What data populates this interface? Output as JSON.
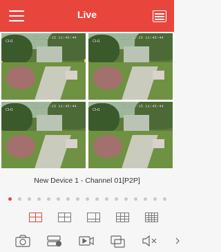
{
  "header": {
    "title": "Live"
  },
  "cameras": [
    {
      "timestamp": "2016-12-15 11:45:44",
      "channel": "CH1",
      "selected": true
    },
    {
      "timestamp": "2016-12-15 11:45:44",
      "channel": "CH1",
      "selected": false
    },
    {
      "timestamp": "2016-12-15 11:45:44",
      "channel": "CH1",
      "selected": false
    },
    {
      "timestamp": "2016-12-15 11:45:44",
      "channel": "CH1",
      "selected": false
    }
  ],
  "device_name": "New Device 1 - Channel 01[P2P]",
  "pager": {
    "total": 17,
    "active_index": 0
  },
  "layouts": [
    "layout-1x4-icon",
    "layout-2x2-icon",
    "layout-1plus3-icon",
    "layout-3x3-icon",
    "layout-4x4-icon"
  ],
  "toolbar": [
    "snapshot-icon",
    "record-icon",
    "playback-icon",
    "multi-screen-icon",
    "mute-icon"
  ],
  "colors": {
    "accent": "#e8463d",
    "selected_border": "#e6c84a"
  }
}
